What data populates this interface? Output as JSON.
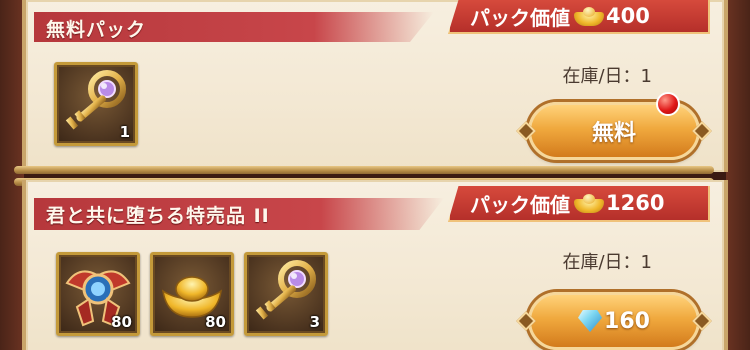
{
  "packs": [
    {
      "title": "無料パック",
      "value_label": "パック価値",
      "value": "400",
      "stock": "在庫/日：1",
      "items": [
        {
          "icon": "golden-key-icon",
          "qty": "1"
        }
      ],
      "button": {
        "label": "無料",
        "has_notification": true
      }
    },
    {
      "title": "君と共に堕ちる特売品 II",
      "value_label": "パック価値",
      "value": "1260",
      "stock": "在庫/日：1",
      "items": [
        {
          "icon": "winged-emblem-icon",
          "qty": "80"
        },
        {
          "icon": "gold-ingot-icon",
          "qty": "80"
        },
        {
          "icon": "golden-key-icon",
          "qty": "3"
        }
      ],
      "button": {
        "label": "160",
        "currency_icon": "diamond-gem-icon"
      }
    }
  ],
  "colors": {
    "title_band": "#c8464a",
    "value_tag": "#c13a32",
    "button": "#f0a93e",
    "panel": "#f5ecda"
  }
}
